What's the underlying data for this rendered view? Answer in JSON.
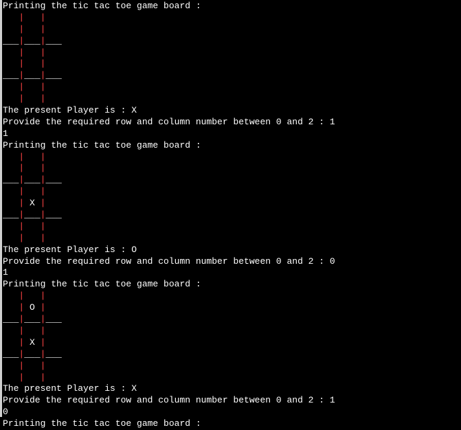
{
  "turns": [
    {
      "header": "Printing the tic tac toe game board :",
      "board": [
        [
          " ",
          " ",
          " "
        ],
        [
          " ",
          " ",
          " "
        ],
        [
          " ",
          " ",
          " "
        ]
      ],
      "player_line": "The present Player is : X",
      "prompt_line": "Provide the required row and column number between 0 and 2 : 1",
      "input_line": "1"
    },
    {
      "header": "Printing the tic tac toe game board :",
      "board": [
        [
          " ",
          " ",
          " "
        ],
        [
          " ",
          "X",
          " "
        ],
        [
          " ",
          " ",
          " "
        ]
      ],
      "player_line": "The present Player is : O",
      "prompt_line": "Provide the required row and column number between 0 and 2 : 0",
      "input_line": "1"
    },
    {
      "header": "Printing the tic tac toe game board :",
      "board": [
        [
          " ",
          "O",
          " "
        ],
        [
          " ",
          "X",
          " "
        ],
        [
          " ",
          " ",
          " "
        ]
      ],
      "player_line": "The present Player is : X",
      "prompt_line": "Provide the required row and column number between 0 and 2 : 1",
      "input_line": "0"
    },
    {
      "header": "Printing the tic tac toe game board :",
      "board": null,
      "player_line": null,
      "prompt_line": null,
      "input_line": null
    }
  ],
  "board_render": {
    "pipe": " | ",
    "divider_cell": "___",
    "divider_pipe": "|"
  }
}
